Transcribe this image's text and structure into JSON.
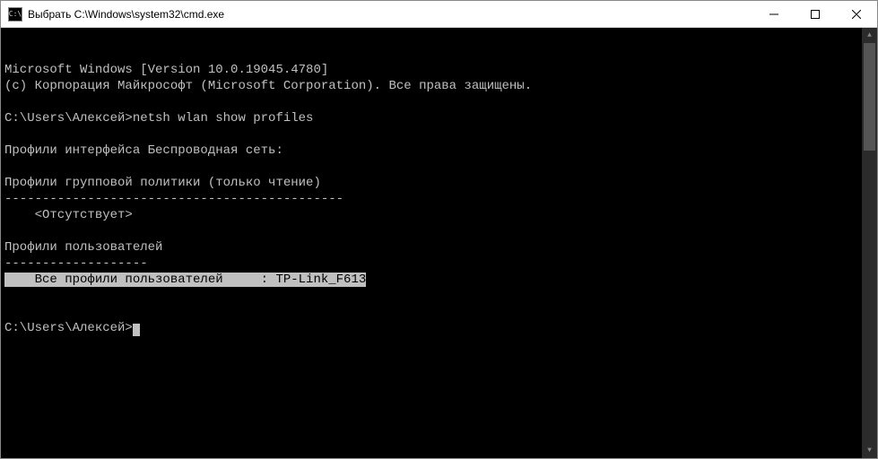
{
  "titlebar": {
    "icon_label": "C:\\",
    "title": "Выбрать C:\\Windows\\system32\\cmd.exe"
  },
  "terminal": {
    "version_line": "Microsoft Windows [Version 10.0.19045.4780]",
    "copyright_line": "(c) Корпорация Майкрософт (Microsoft Corporation). Все права защищены.",
    "blank": "",
    "prompt1_path": "C:\\Users\\Алексей>",
    "command1": "netsh wlan show profiles",
    "section_interface": "Профили интерфейса Беспроводная сеть:",
    "section_group_policy": "Профили групповой политики (только чтение)",
    "divider": "---------------------------------------------",
    "absent": "    <Отсутствует>",
    "section_user_profiles": "Профили пользователей",
    "divider2": "-------------------",
    "highlighted_profile": "    Все профили пользователей     : TP-Link_F613",
    "prompt2_path": "C:\\Users\\Алексей>"
  }
}
